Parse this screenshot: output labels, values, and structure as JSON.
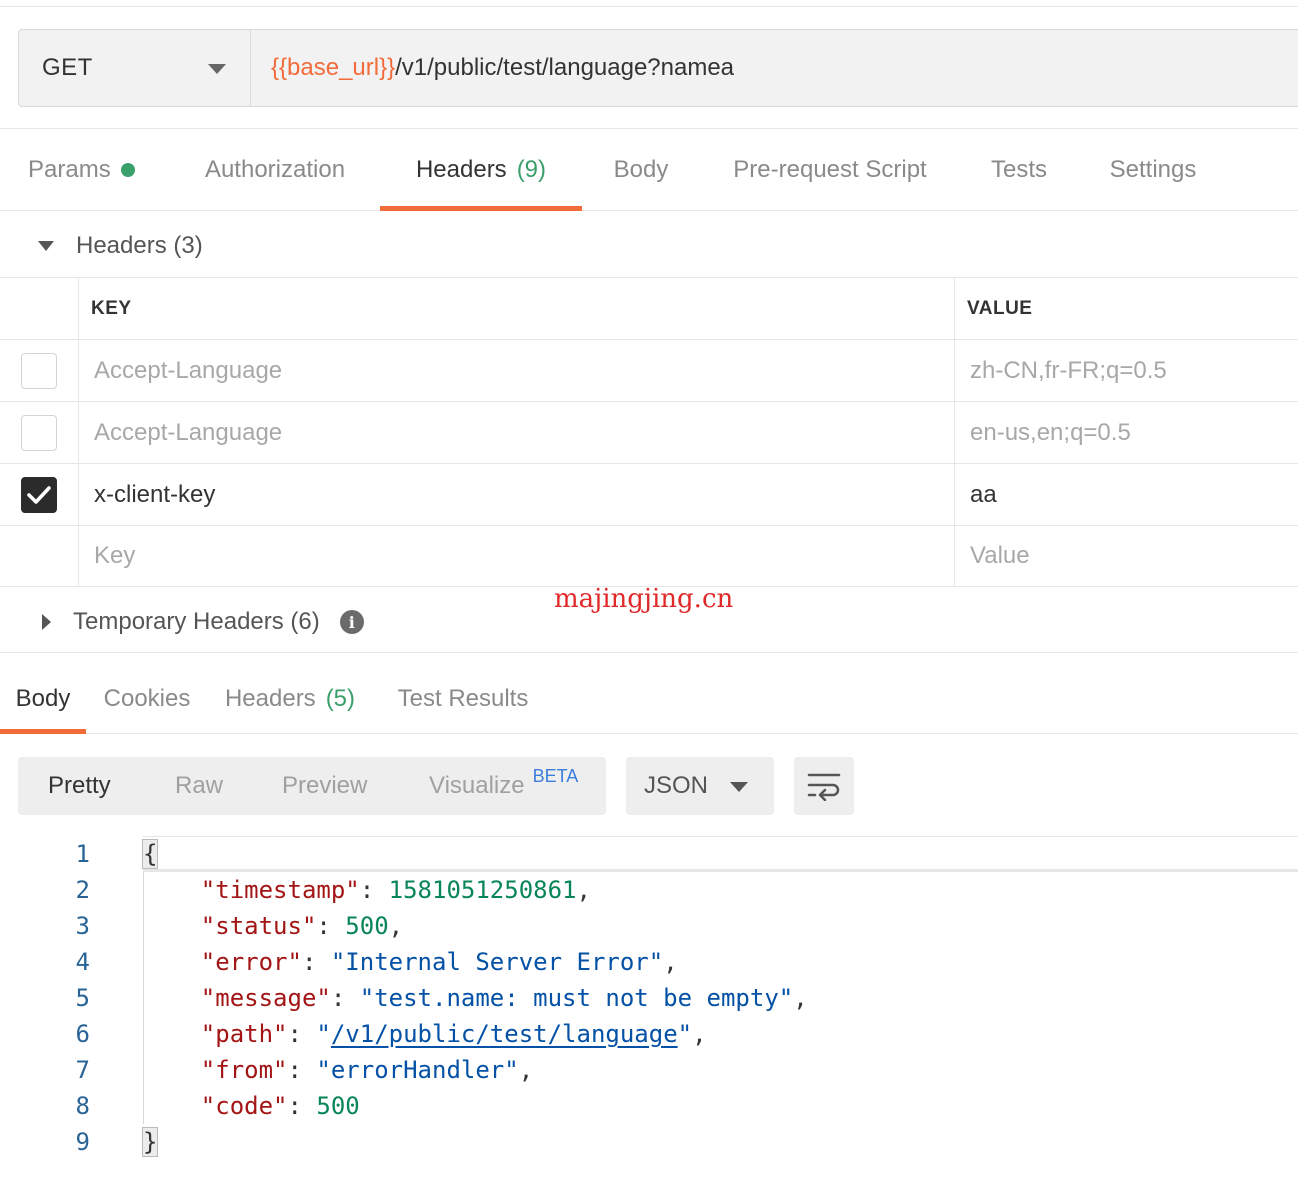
{
  "request": {
    "method": "GET",
    "url_variable": "{{base_url}}",
    "url_path": "/v1/public/test/language?namea"
  },
  "request_tabs": [
    {
      "label": "Params",
      "dot": true
    },
    {
      "label": "Authorization"
    },
    {
      "label": "Headers",
      "count": "(9)",
      "active": true
    },
    {
      "label": "Body"
    },
    {
      "label": "Pre-request Script"
    },
    {
      "label": "Tests"
    },
    {
      "label": "Settings"
    }
  ],
  "headers_section": {
    "title": "Headers",
    "count": "(3)",
    "columns": {
      "key": "KEY",
      "value": "VALUE"
    },
    "rows": [
      {
        "checked": false,
        "key": "Accept-Language",
        "value": "zh-CN,fr-FR;q=0.5"
      },
      {
        "checked": false,
        "key": "Accept-Language",
        "value": "en-us,en;q=0.5"
      },
      {
        "checked": true,
        "key": "x-client-key",
        "value": "aa"
      }
    ],
    "new_row": {
      "key_placeholder": "Key",
      "value_placeholder": "Value"
    }
  },
  "temporary_headers": {
    "title": "Temporary Headers",
    "count": "(6)",
    "icon": "info-icon"
  },
  "watermark": "majingjing.cn",
  "response_tabs": [
    {
      "label": "Body",
      "active": true
    },
    {
      "label": "Cookies"
    },
    {
      "label": "Headers",
      "count": "(5)"
    },
    {
      "label": "Test Results"
    }
  ],
  "view_modes": {
    "pretty": "Pretty",
    "raw": "Raw",
    "preview": "Preview",
    "visualize": "Visualize",
    "beta": "BETA"
  },
  "format": "JSON",
  "code": {
    "line_numbers": [
      "1",
      "2",
      "3",
      "4",
      "5",
      "6",
      "7",
      "8",
      "9"
    ],
    "open_brace": "{",
    "close_brace": "}",
    "fields": [
      {
        "key": "\"timestamp\"",
        "value": "1581051250861",
        "type": "number"
      },
      {
        "key": "\"status\"",
        "value": "500",
        "type": "number"
      },
      {
        "key": "\"error\"",
        "value": "\"Internal Server Error\"",
        "type": "string"
      },
      {
        "key": "\"message\"",
        "value": "\"test.name: must not be empty\"",
        "type": "string"
      },
      {
        "key": "\"path\"",
        "value": "/v1/public/test/language",
        "type": "link"
      },
      {
        "key": "\"from\"",
        "value": "\"errorHandler\"",
        "type": "string"
      },
      {
        "key": "\"code\"",
        "value": "500",
        "type": "number"
      }
    ]
  },
  "colors": {
    "accent": "#f26b3a",
    "count_green": "#3a9f6b",
    "json_key": "#a31515",
    "json_number": "#098658",
    "json_string": "#0451a5"
  }
}
